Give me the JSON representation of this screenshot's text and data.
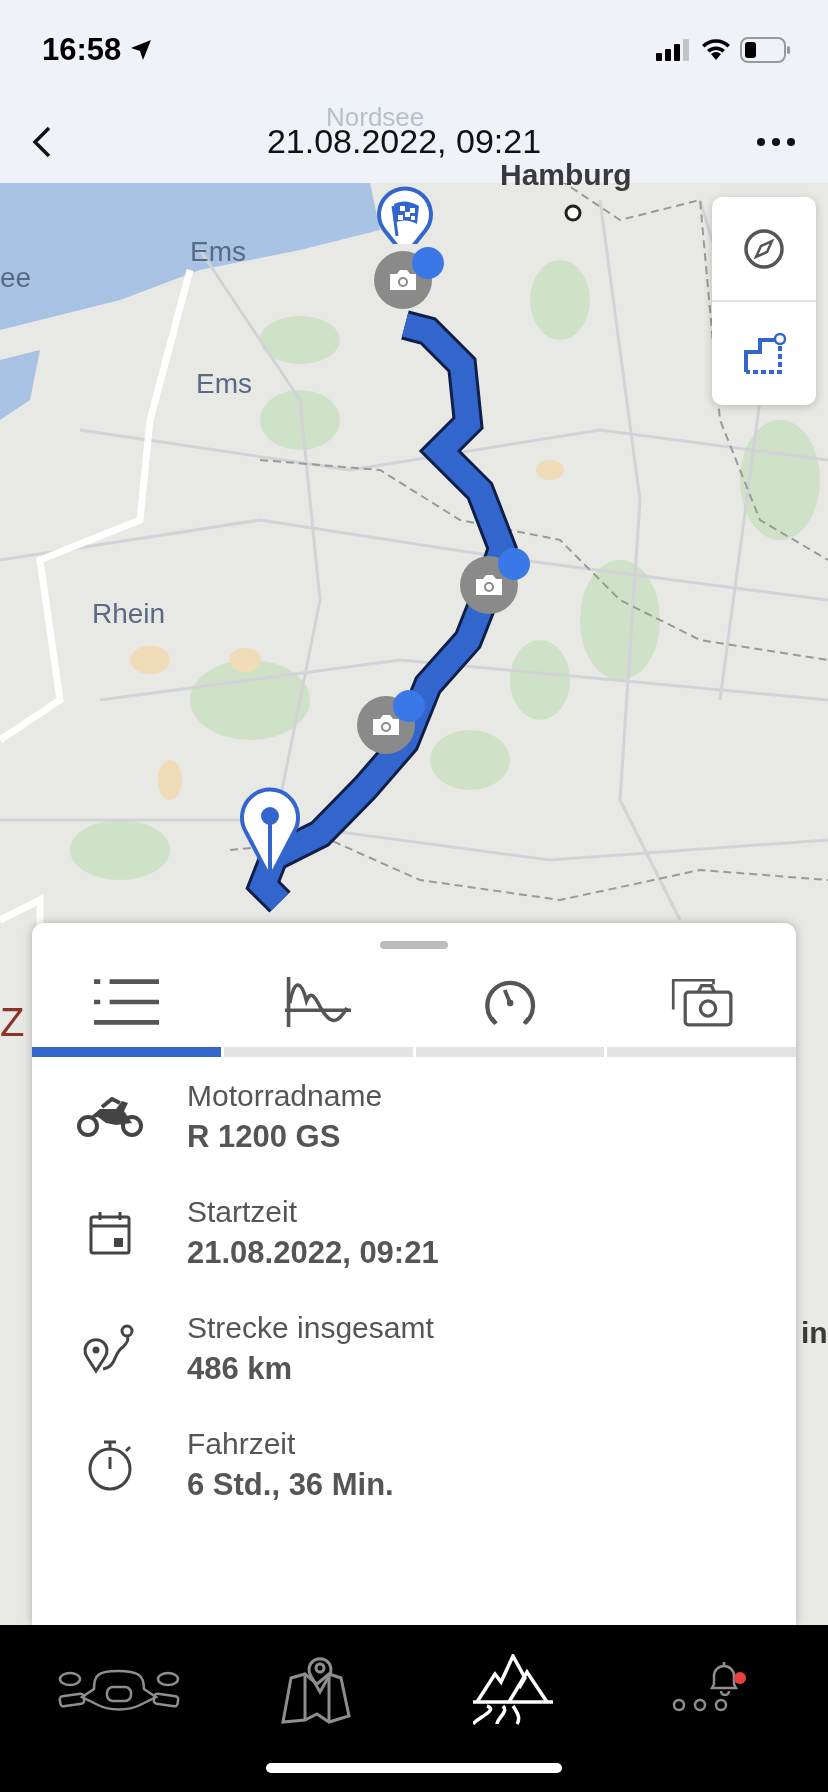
{
  "status_bar": {
    "time": "16:58"
  },
  "header": {
    "title": "21.08.2022, 09:21"
  },
  "map": {
    "labels": [
      {
        "text": "Nordsee",
        "kind": "faint"
      },
      {
        "text": "Hamburg",
        "kind": "city"
      },
      {
        "text": "Ems",
        "kind": "water"
      },
      {
        "text": "Ems",
        "kind": "water"
      },
      {
        "text": "ee",
        "kind": "water"
      },
      {
        "text": "Rhein",
        "kind": "water"
      },
      {
        "text": "Z",
        "kind": "region"
      },
      {
        "text": "in",
        "kind": "city"
      }
    ]
  },
  "sheet": {
    "tabs": [
      {
        "kind": "list",
        "selected": true
      },
      {
        "kind": "chart",
        "selected": false
      },
      {
        "kind": "gauge",
        "selected": false
      },
      {
        "kind": "photos",
        "selected": false
      }
    ],
    "details": [
      {
        "kind": "motorcycle",
        "label": "Motorradname",
        "value": "R 1200 GS"
      },
      {
        "kind": "calendar",
        "label": "Startzeit",
        "value": "21.08.2022, 09:21"
      },
      {
        "kind": "route",
        "label": "Strecke insgesamt",
        "value": "486 km"
      },
      {
        "kind": "stopwatch",
        "label": "Fahrzeit",
        "value": "6 Std., 36 Min."
      }
    ]
  },
  "tab_bar": {
    "items": [
      {
        "kind": "handlebar",
        "selected": false,
        "badge": false
      },
      {
        "kind": "map",
        "selected": false,
        "badge": false
      },
      {
        "kind": "mountains",
        "selected": true,
        "badge": false
      },
      {
        "kind": "more",
        "selected": false,
        "badge": true
      }
    ]
  }
}
